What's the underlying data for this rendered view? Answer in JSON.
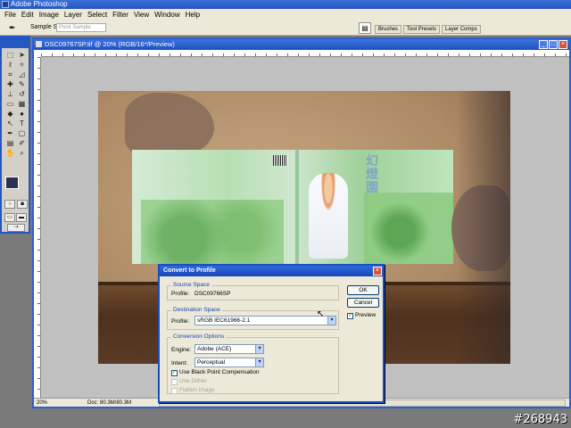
{
  "app": {
    "title": "Adobe Photoshop"
  },
  "menu": [
    "File",
    "Edit",
    "Image",
    "Layer",
    "Select",
    "Filter",
    "View",
    "Window",
    "Help"
  ],
  "options_bar": {
    "sample_label": "Sample Size:",
    "sample_value": "Point Sample",
    "palette_tabs": [
      "Brushes",
      "Tool Presets",
      "Layer Comps"
    ]
  },
  "document": {
    "title": "DSC09767SP.tif @ 20% (RGB/16*/Preview)",
    "zoom": "20%",
    "doc_size": "Doc: 80.3M/80.3M"
  },
  "dialog": {
    "title": "Convert to Profile",
    "source_group": "Source Space",
    "source_profile_label": "Profile:",
    "source_profile_value": "DSC09766SP",
    "dest_group": "Destination Space",
    "dest_profile_label": "Profile:",
    "dest_profile_value": "sRGB IEC61966-2.1",
    "options_group": "Conversion Options",
    "engine_label": "Engine:",
    "engine_value": "Adobe (ACE)",
    "intent_label": "Intent:",
    "intent_value": "Perceptual",
    "black_point": "Use Black Point Compensation",
    "use_dither": "Use Dither",
    "flatten": "Flatten Image",
    "ok": "OK",
    "cancel": "Cancel",
    "preview": "Preview"
  },
  "watermark": "#268943"
}
